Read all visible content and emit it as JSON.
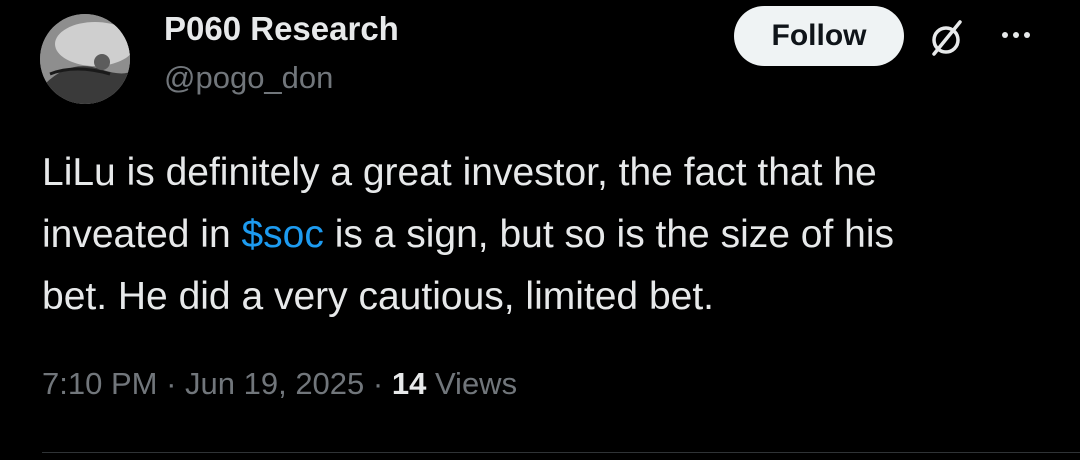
{
  "author": {
    "display_name": "P060 Research",
    "handle": "@pogo_don"
  },
  "actions": {
    "follow_label": "Follow"
  },
  "tweet": {
    "line1": "LiLu is definitely a great investor, the fact that he",
    "line2_before": "inveated in ",
    "line2_cashtag": "$soc",
    "line2_after": " is a sign, but so is the size of his",
    "line3": "bet. He did a very cautious, limited bet."
  },
  "meta": {
    "time": "7:10 PM",
    "sep1": " · ",
    "date": "Jun 19, 2025",
    "sep2": " · ",
    "views_count": "14",
    "views_label": " Views"
  },
  "icons": {
    "grok": "grok-icon",
    "more": "more-options-icon"
  },
  "colors": {
    "background": "#000000",
    "text": "#e7e9ea",
    "secondary": "#71767b",
    "link": "#1d9bf0",
    "button_bg": "#eff3f4"
  }
}
